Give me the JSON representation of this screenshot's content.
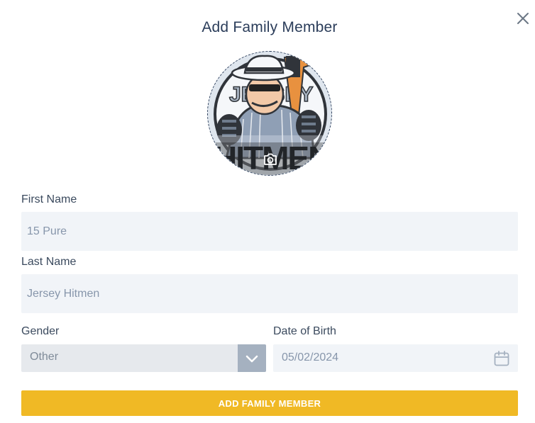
{
  "modal": {
    "title": "Add Family Member"
  },
  "icons": {
    "close": "close-icon",
    "camera": "camera-icon",
    "chevron": "chevron-down-icon",
    "calendar": "calendar-icon"
  },
  "avatar": {
    "logo_text_top": "JERSEY",
    "logo_text_bottom": "HITMEN"
  },
  "form": {
    "first_name": {
      "label": "First Name",
      "value": "15 Pure"
    },
    "last_name": {
      "label": "Last Name",
      "value": "Jersey Hitmen"
    },
    "gender": {
      "label": "Gender",
      "value": "Other"
    },
    "dob": {
      "label": "Date of Birth",
      "value": "05/02/2024"
    },
    "submit_label": "ADD FAMILY MEMBER"
  },
  "colors": {
    "accent": "#f0b925",
    "title": "#2b3d5a",
    "field_bg": "#f1f4f8",
    "select_btn": "#a5b1c0"
  }
}
